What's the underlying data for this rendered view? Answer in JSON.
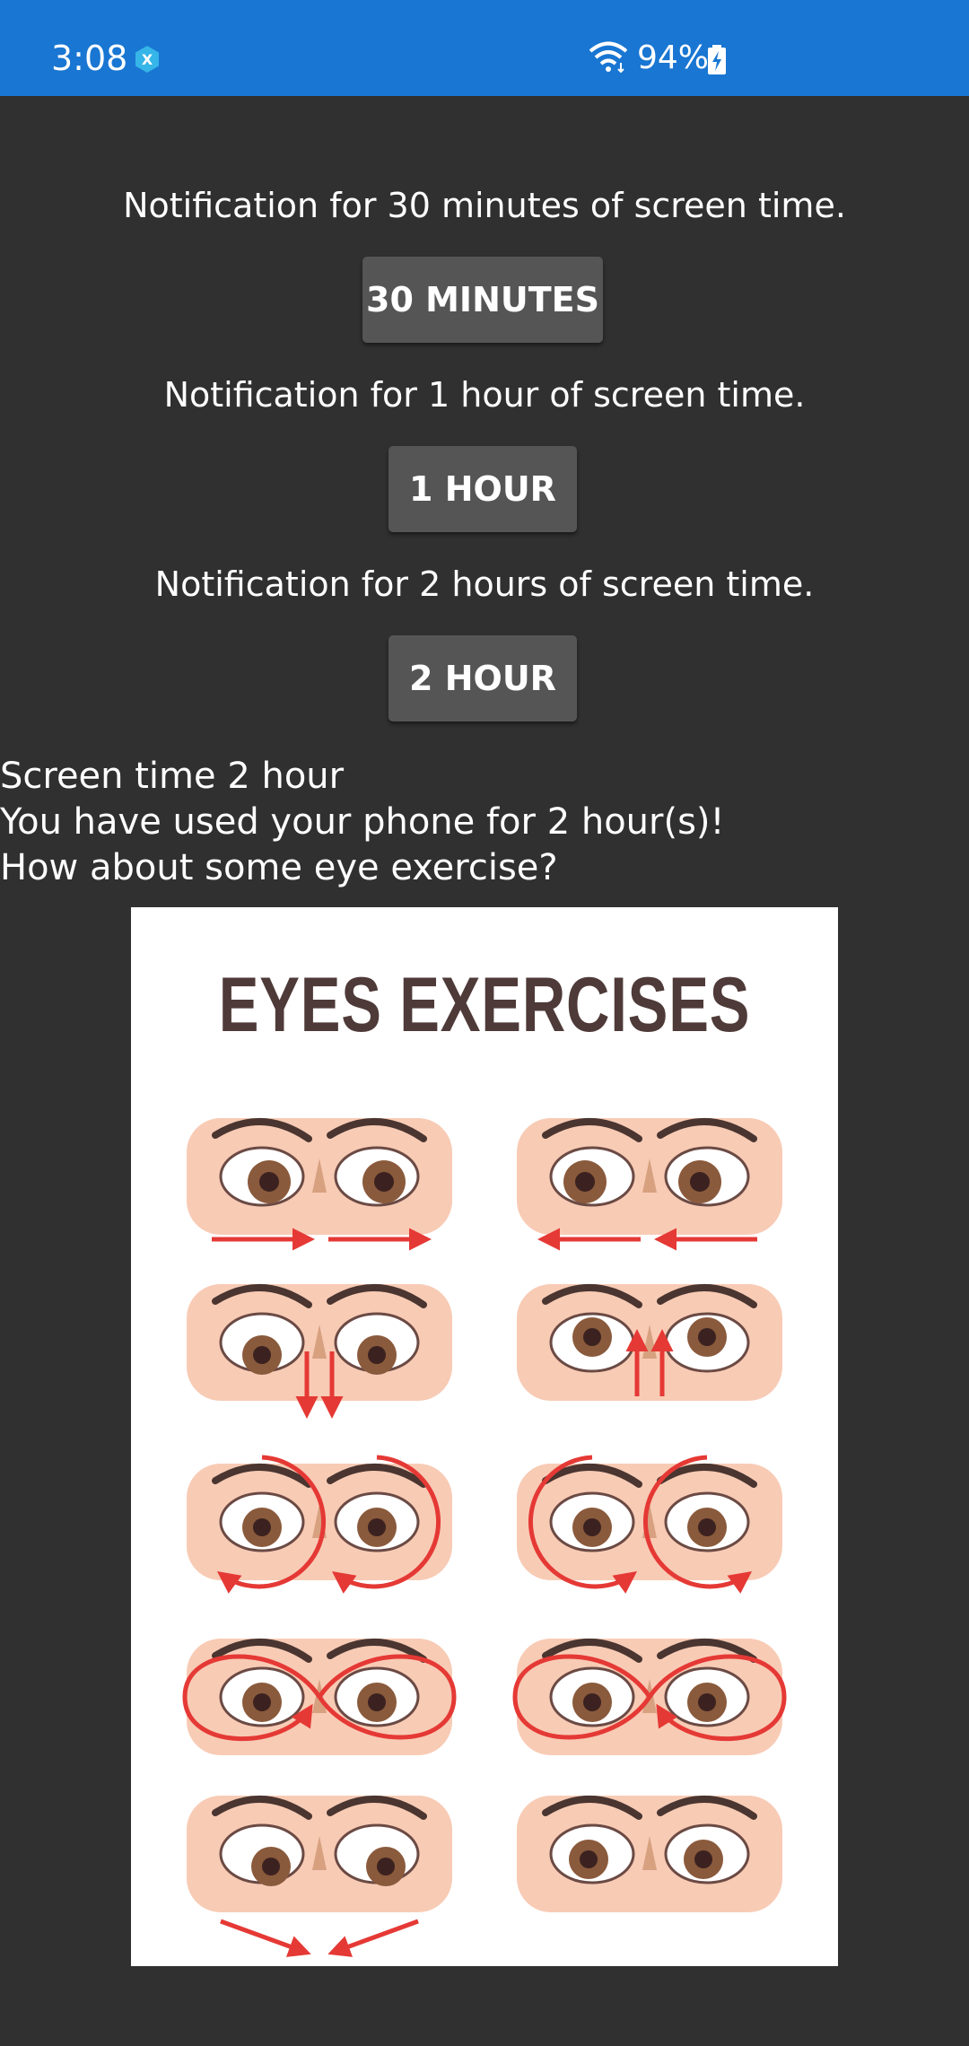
{
  "status_bar": {
    "time": "3:08",
    "battery": "94%",
    "background_color": "#1976d2"
  },
  "options": [
    {
      "description": "Notification for 30 minutes of screen time.",
      "button_label": "30 MINUTES"
    },
    {
      "description": "Notification for 1 hour of screen time.",
      "button_label": "1 HOUR"
    },
    {
      "description": "Notification for 2 hours of screen time.",
      "button_label": "2 HOUR"
    }
  ],
  "message": {
    "title": "Screen time 2 hour",
    "body": "You have used your phone for 2 hour(s)!",
    "prompt": "How about some eye exercise?"
  },
  "poster": {
    "title": "EYES EXERCISES"
  },
  "colors": {
    "background": "#303030",
    "button": "#555555",
    "arrow": "#e53935",
    "skin": "#f8cbb5"
  }
}
